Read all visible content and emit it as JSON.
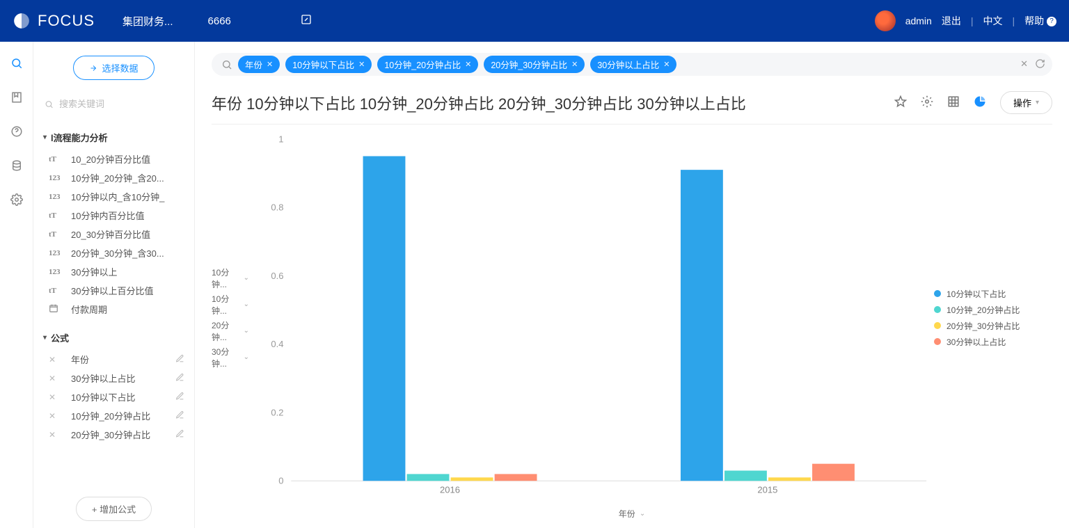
{
  "header": {
    "brand": "FOCUS",
    "crumb1": "集团财务...",
    "crumb2": "6666",
    "user": "admin",
    "logout": "退出",
    "lang": "中文",
    "help": "帮助"
  },
  "side": {
    "select_data_btn": "选择数据",
    "search_placeholder": "搜索关键词",
    "group1_title": "l流程能力分析",
    "fields1": [
      {
        "icon": "tT",
        "label": "10_20分钟百分比值"
      },
      {
        "icon": "123",
        "label": "10分钟_20分钟_含20..."
      },
      {
        "icon": "123",
        "label": "10分钟以内_含10分钟_"
      },
      {
        "icon": "tT",
        "label": "10分钟内百分比值"
      },
      {
        "icon": "tT",
        "label": "20_30分钟百分比值"
      },
      {
        "icon": "123",
        "label": "20分钟_30分钟_含30..."
      },
      {
        "icon": "123",
        "label": "30分钟以上"
      },
      {
        "icon": "tT",
        "label": "30分钟以上百分比值"
      },
      {
        "icon": "cal",
        "label": "付款周期"
      }
    ],
    "group2_title": "公式",
    "formulas": [
      {
        "label": "年份"
      },
      {
        "label": "30分钟以上占比"
      },
      {
        "label": "10分钟以下占比"
      },
      {
        "label": "10分钟_20分钟占比"
      },
      {
        "label": "20分钟_30分钟占比"
      }
    ],
    "add_formula_btn": "+  增加公式"
  },
  "query": {
    "chips": [
      "年份",
      "10分钟以下占比",
      "10分钟_20分钟占比",
      "20分钟_30分钟占比",
      "30分钟以上占比"
    ],
    "title": "年份 10分钟以下占比 10分钟_20分钟占比 20分钟_30分钟占比 30分钟以上占比",
    "ops_btn": "操作"
  },
  "ylabels": [
    "10分钟...",
    "10分钟...",
    "20分钟...",
    "30分钟..."
  ],
  "chart_data": {
    "type": "bar",
    "xlabel": "年份",
    "ylim": [
      0,
      1
    ],
    "yticks": [
      0,
      0.2,
      0.4,
      0.6,
      0.8,
      1
    ],
    "categories": [
      "2016",
      "2015"
    ],
    "series": [
      {
        "name": "10分钟以下占比",
        "color": "#2da4ea",
        "values": [
          0.95,
          0.91
        ]
      },
      {
        "name": "10分钟_20分钟占比",
        "color": "#4fd6d0",
        "values": [
          0.02,
          0.03
        ]
      },
      {
        "name": "20分钟_30分钟占比",
        "color": "#ffd84d",
        "values": [
          0.01,
          0.01
        ]
      },
      {
        "name": "30分钟以上占比",
        "color": "#ff8e72",
        "values": [
          0.02,
          0.05
        ]
      }
    ]
  }
}
